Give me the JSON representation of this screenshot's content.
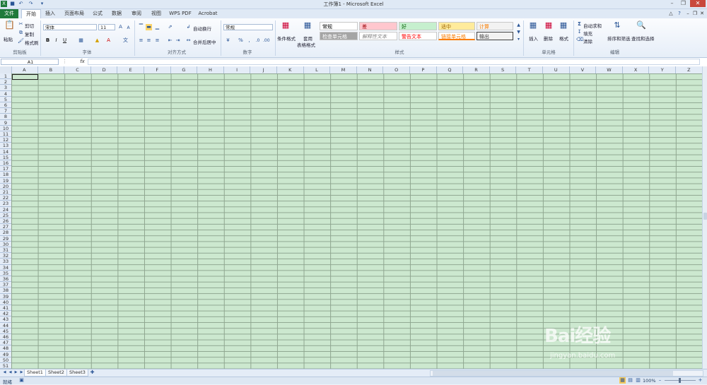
{
  "window": {
    "title": "工作簿1 - Microsoft Excel",
    "qat": [
      "save-icon",
      "undo-icon",
      "redo-icon",
      "customize-icon"
    ]
  },
  "tabs": [
    "文件",
    "开始",
    "插入",
    "页面布局",
    "公式",
    "数据",
    "审阅",
    "视图",
    "WPS PDF",
    "Acrobat"
  ],
  "ribbon": {
    "clipboard": {
      "paste": "粘贴",
      "cut": "剪切",
      "copy": "复制",
      "format_painter": "格式刷",
      "label": "剪贴板"
    },
    "font": {
      "name": "宋体",
      "size": "11",
      "bold": "B",
      "italic": "I",
      "underline": "U",
      "label": "字体"
    },
    "alignment": {
      "wrap": "自动换行",
      "merge": "合并后居中",
      "label": "对齐方式"
    },
    "number": {
      "format": "常规",
      "percent": "%",
      "comma": ",",
      "label": "数字"
    },
    "styles": {
      "conditional": "条件格式",
      "table": "套用",
      "table2": "表格格式",
      "cells": [
        {
          "text": "常规",
          "bg": "#ffffff",
          "fg": "#000000"
        },
        {
          "text": "差",
          "bg": "#ffc7ce",
          "fg": "#9c0006"
        },
        {
          "text": "好",
          "bg": "#c6efce",
          "fg": "#006100"
        },
        {
          "text": "适中",
          "bg": "#ffeb9c",
          "fg": "#9c6500"
        },
        {
          "text": "计算",
          "bg": "#f2f2f2",
          "fg": "#fa7d00"
        },
        {
          "text": "检查单元格",
          "bg": "#a5a5a5",
          "fg": "#ffffff"
        },
        {
          "text": "解释性文本",
          "bg": "#ffffff",
          "fg": "#7f7f7f"
        },
        {
          "text": "警告文本",
          "bg": "#ffffff",
          "fg": "#ff0000"
        },
        {
          "text": "链接单元格",
          "bg": "#ffffff",
          "fg": "#fa7d00"
        },
        {
          "text": "输出",
          "bg": "#f2f2f2",
          "fg": "#3f3f3f"
        }
      ],
      "label": "样式"
    },
    "cells": {
      "insert": "插入",
      "delete": "删除",
      "format": "格式",
      "label": "单元格"
    },
    "editing": {
      "autosum": "自动求和",
      "fill": "填充",
      "clear": "清除",
      "sort": "排序和筛选",
      "find": "查找和选择",
      "label": "编辑"
    }
  },
  "formula_bar": {
    "name_box": "A1",
    "fx": "fx",
    "value": ""
  },
  "columns": [
    "A",
    "B",
    "C",
    "D",
    "E",
    "F",
    "G",
    "H",
    "I",
    "J",
    "K",
    "L",
    "M",
    "N",
    "O",
    "P",
    "Q",
    "R",
    "S",
    "T",
    "U",
    "V",
    "W",
    "X",
    "Y",
    "Z"
  ],
  "rows": [
    "1",
    "2",
    "3",
    "4",
    "5",
    "6",
    "7",
    "8",
    "9",
    "10",
    "11",
    "12",
    "13",
    "14",
    "15",
    "16",
    "17",
    "18",
    "19",
    "20",
    "21",
    "22",
    "23",
    "24",
    "25",
    "26",
    "27",
    "28",
    "29",
    "30",
    "31",
    "32",
    "33",
    "34",
    "35",
    "36",
    "37",
    "38",
    "39",
    "40",
    "41",
    "42",
    "43",
    "44",
    "45",
    "46",
    "47",
    "48",
    "49",
    "50",
    "51"
  ],
  "sheets": [
    "Sheet1",
    "Sheet2",
    "Sheet3"
  ],
  "status": {
    "ready": "就绪",
    "zoom": "100%"
  },
  "watermark": {
    "logo": "Bai经验",
    "url": "jingyan.baidu.com"
  },
  "colors": {
    "grid_bg": "#cce8cf",
    "file_tab": "#1f7a3b"
  }
}
